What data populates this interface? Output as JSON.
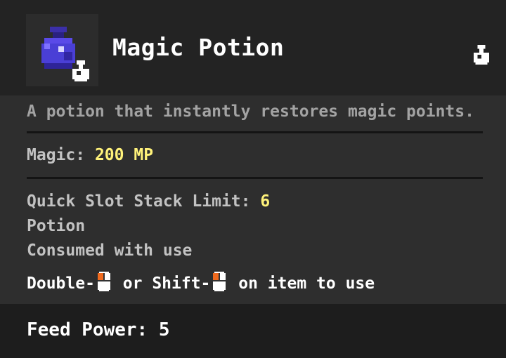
{
  "item": {
    "name": "Magic Potion",
    "icon": "purple-potion-icon",
    "badge_icon": "flask-icon",
    "corner_icon": "flask-icon"
  },
  "description": "A potion that instantly restores magic points.",
  "stats": {
    "magic_label": "Magic:",
    "magic_value": "200 MP"
  },
  "info": {
    "stack_label": "Quick Slot Stack Limit:",
    "stack_value": "6",
    "category": "Potion",
    "consumed": "Consumed with use"
  },
  "usage": {
    "part1": "Double-",
    "part2": " or Shift-",
    "part3": " on item to use",
    "mouse_icon": "left-mouse-click-icon"
  },
  "footer": {
    "feed_power": "Feed Power: 5"
  },
  "colors": {
    "value_highlight": "#fff27a",
    "potion_primary": "#4a3fd6",
    "mouse_button": "#f06a1e"
  }
}
